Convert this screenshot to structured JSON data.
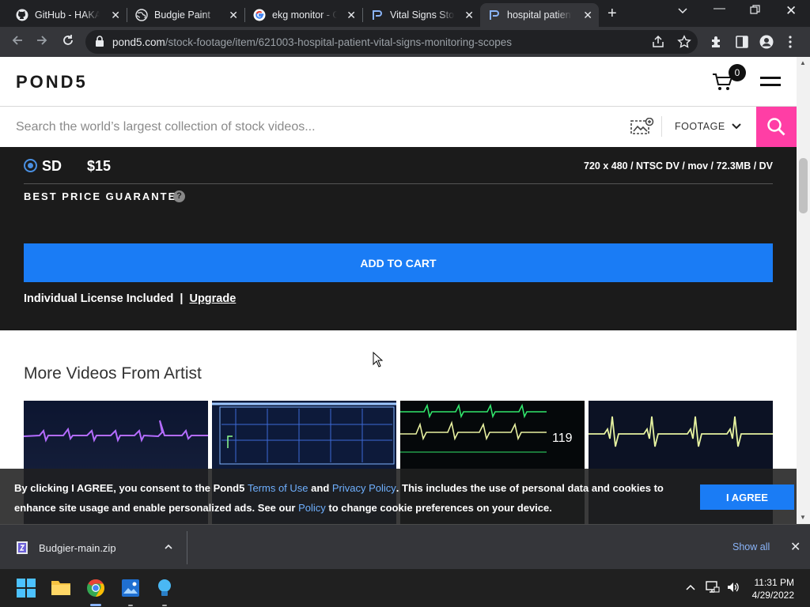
{
  "browser": {
    "tabs": [
      {
        "title": "GitHub - HAKAN",
        "icon": "github-icon"
      },
      {
        "title": "Budgie Paint",
        "icon": "globe-icon"
      },
      {
        "title": "ekg monitor - G",
        "icon": "google-icon"
      },
      {
        "title": "Vital Signs Stock",
        "icon": "pond5-icon"
      },
      {
        "title": "hospital patient",
        "icon": "pond5-icon",
        "active": true
      }
    ],
    "url_domain": "pond5.com",
    "url_path": "/stock-footage/item/621003-hospital-patient-vital-signs-monitoring-scopes"
  },
  "site": {
    "logo": "POND5",
    "cart_count": "0",
    "search_placeholder": "Search the world’s largest collection of stock videos...",
    "search_category": "FOOTAGE"
  },
  "product": {
    "resolution": "SD",
    "price": "$15",
    "specs": "720 x 480 / NTSC DV / mov / 72.3MB / DV",
    "best_price": "BEST PRICE GUARANTEE",
    "help": "?",
    "add_to_cart": "ADD TO CART",
    "license_text": "Individual License Included",
    "license_sep": "|",
    "upgrade": "Upgrade"
  },
  "more_videos": {
    "heading": "More Videos From Artist"
  },
  "cookie": {
    "t1": "By clicking I AGREE, you consent to the Pond5 ",
    "terms": "Terms of Use",
    "t2": " and ",
    "privacy": "Privacy Policy",
    "t3": ". This includes the use of personal data and cookies to enhance site usage and enable personalized ads. See our ",
    "policy": "Policy",
    "t4": " to change cookie preferences on your device.",
    "agree": "I AGREE"
  },
  "downloads": {
    "file": "Budgier-main.zip",
    "show_all": "Show all"
  },
  "taskbar": {
    "time": "11:31 PM",
    "date": "4/29/2022"
  },
  "colors": {
    "accent_blue": "#1a7cf5",
    "search_pink": "#ff3ea5"
  }
}
